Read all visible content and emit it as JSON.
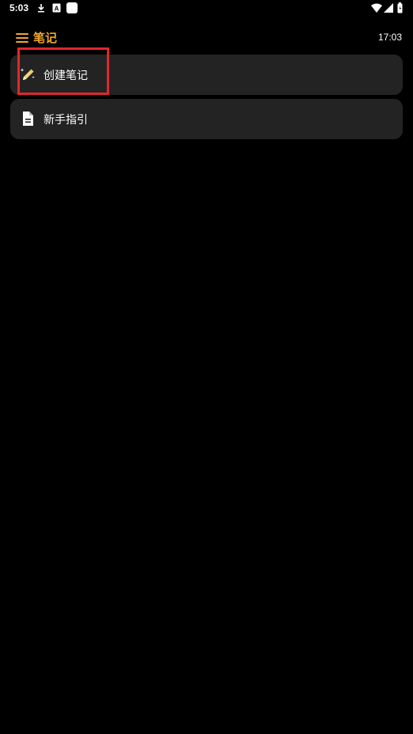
{
  "status_bar": {
    "time": "5:03",
    "icons": [
      "download-icon",
      "a-icon",
      "square-icon",
      "wifi-icon",
      "signal-icon",
      "battery-icon"
    ]
  },
  "header": {
    "title": "笔记",
    "clock": "17:03",
    "menu_icon": "hamburger-menu-icon",
    "accent_color": "#f2a530"
  },
  "items": [
    {
      "label": "创建笔记",
      "icon": "pencil-sparkle-icon"
    },
    {
      "label": "新手指引",
      "icon": "document-icon"
    }
  ],
  "highlight": {
    "color": "#e0272c",
    "target": "创建笔记"
  },
  "colors": {
    "background": "#000000",
    "card": "#232323",
    "text": "#ffffff"
  }
}
